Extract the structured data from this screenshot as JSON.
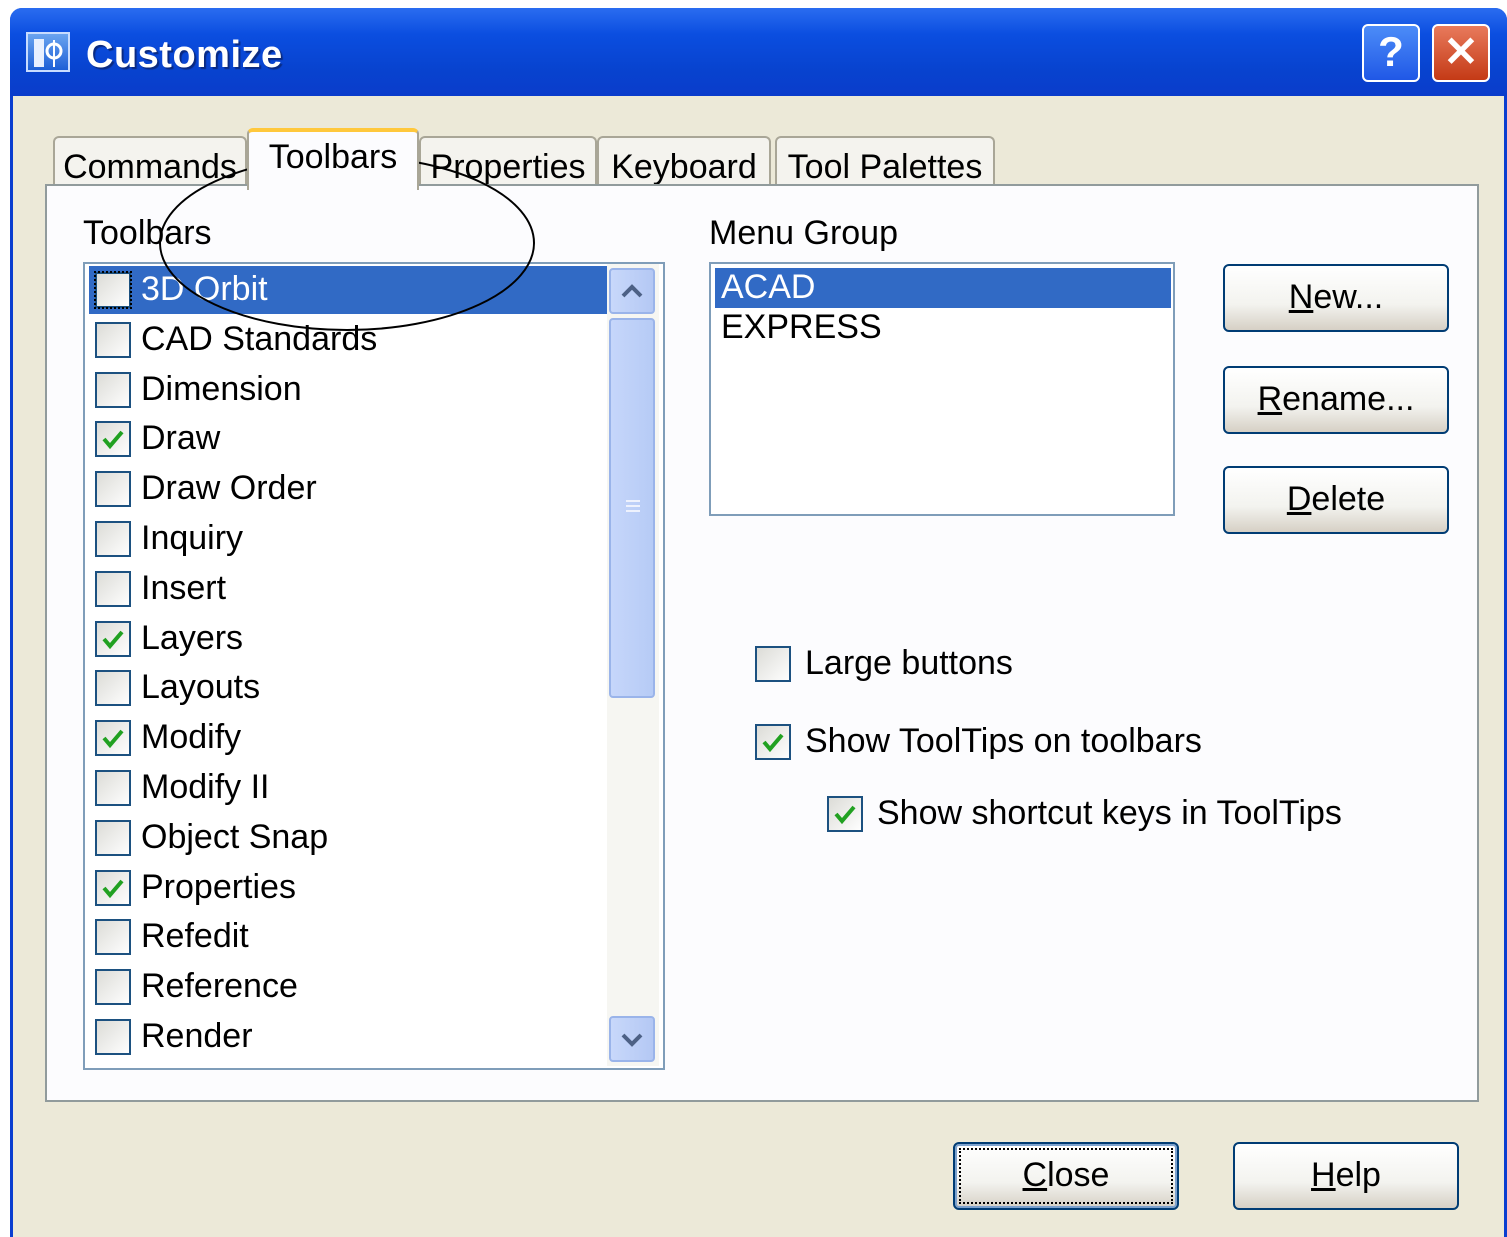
{
  "window": {
    "title": "Customize",
    "help_glyph": "?",
    "close_glyph": "✕"
  },
  "tabs": [
    {
      "label": "Commands",
      "active": false
    },
    {
      "label": "Toolbars",
      "active": true
    },
    {
      "label": "Properties",
      "active": false
    },
    {
      "label": "Keyboard",
      "active": false
    },
    {
      "label": "Tool Palettes",
      "active": false
    }
  ],
  "toolbars": {
    "label": "Toolbars",
    "items": [
      {
        "label": "3D Orbit",
        "checked": false,
        "selected": true
      },
      {
        "label": "CAD Standards",
        "checked": false
      },
      {
        "label": "Dimension",
        "checked": false
      },
      {
        "label": "Draw",
        "checked": true
      },
      {
        "label": "Draw Order",
        "checked": false
      },
      {
        "label": "Inquiry",
        "checked": false
      },
      {
        "label": "Insert",
        "checked": false
      },
      {
        "label": "Layers",
        "checked": true
      },
      {
        "label": "Layouts",
        "checked": false
      },
      {
        "label": "Modify",
        "checked": true
      },
      {
        "label": "Modify II",
        "checked": false
      },
      {
        "label": "Object Snap",
        "checked": false
      },
      {
        "label": "Properties",
        "checked": true
      },
      {
        "label": "Refedit",
        "checked": false
      },
      {
        "label": "Reference",
        "checked": false
      },
      {
        "label": "Render",
        "checked": false
      }
    ]
  },
  "menu_group": {
    "label": "Menu Group",
    "items": [
      {
        "label": "ACAD",
        "selected": true
      },
      {
        "label": "EXPRESS",
        "selected": false
      }
    ]
  },
  "buttons": {
    "new": "New...",
    "rename": "Rename...",
    "delete": "Delete",
    "close": "Close",
    "help": "Help"
  },
  "options": {
    "large_buttons": {
      "label": "Large buttons",
      "checked": false
    },
    "show_tooltips": {
      "label": "Show ToolTips on toolbars",
      "checked": true
    },
    "show_shortcut_keys": {
      "label": "Show shortcut keys in ToolTips",
      "checked": true
    }
  },
  "colors": {
    "title_bar": "#0a3ed0",
    "selection": "#316ac5",
    "check": "#21a121",
    "dialog_bg": "#ece9d8",
    "active_tab_accent": "#ffc83c"
  }
}
